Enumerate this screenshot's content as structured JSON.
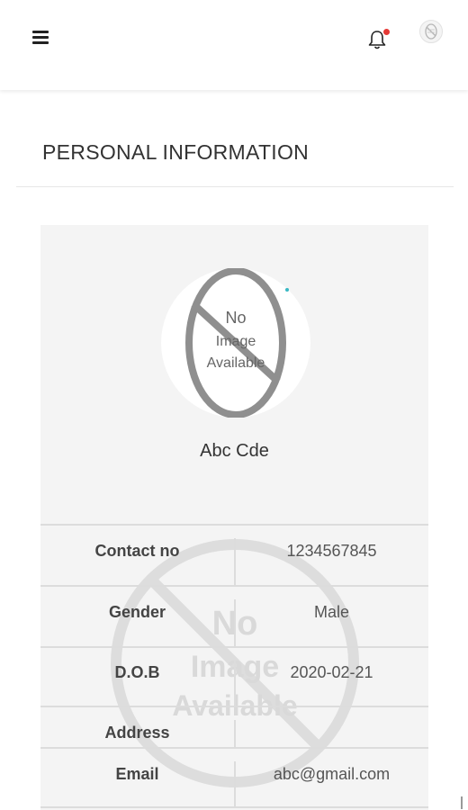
{
  "header": {
    "menu_icon": "hamburger-menu-icon",
    "notification_icon": "bell-icon",
    "notification_dot_color": "#e53935",
    "avatar_icon": "no-image-avatar-icon"
  },
  "page": {
    "title": "PERSONAL INFORMATION"
  },
  "profile": {
    "image_placeholder_lines": [
      "No",
      "Image",
      "Available"
    ],
    "name": "Abc Cde"
  },
  "details": [
    {
      "label": "Contact no",
      "value": "1234567845"
    },
    {
      "label": "Gender",
      "value": "Male"
    },
    {
      "label": "D.O.B",
      "value": "2020-02-21"
    },
    {
      "label": "Address",
      "value": ""
    },
    {
      "label": "Email",
      "value": "abc@gmail.com"
    }
  ],
  "watermark_lines": [
    "No",
    "Image",
    "Available"
  ]
}
